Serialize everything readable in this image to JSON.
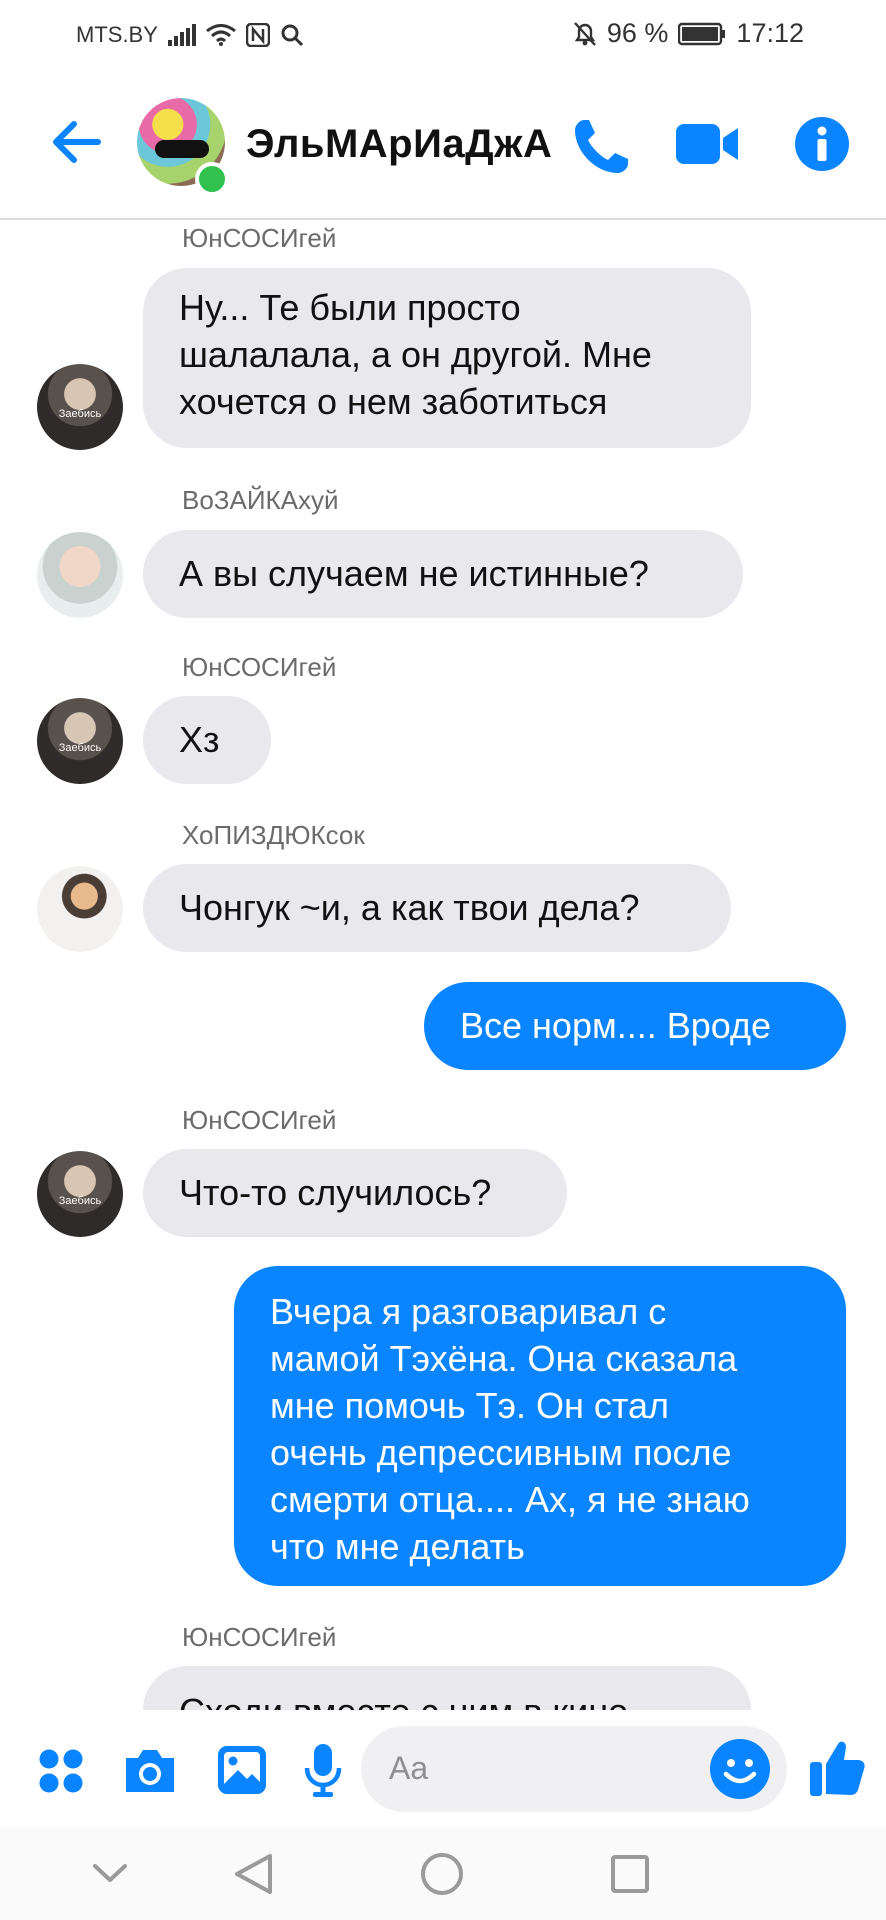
{
  "status_bar": {
    "carrier": "MTS.BY",
    "battery": "96 %",
    "time": "17:12"
  },
  "header": {
    "title": "ЭльМАрИаДжА",
    "back_icon": "arrow-left-icon",
    "call_icon": "phone-icon",
    "video_icon": "video-camera-icon",
    "info_icon": "info-icon",
    "accent_color": "#0b84ff",
    "online_color": "#31c24d"
  },
  "messages": [
    {
      "sender": "ЮнСОСИгей",
      "lines": [
        "Ну... Те были просто",
        "шалалала, а он другой. Мне",
        "хочется о нем заботиться"
      ]
    },
    {
      "sender": "ВоЗАЙКАхуй",
      "lines": [
        "А вы случаем не истинные?"
      ]
    },
    {
      "sender": "ЮнСОСИгей",
      "lines": [
        "Хз"
      ]
    },
    {
      "sender": "ХоПИЗДЮКсок",
      "lines": [
        "Чонгук ~и, а как твои дела?"
      ]
    },
    {
      "outgoing": true,
      "lines": [
        "Все норм.... Вроде"
      ]
    },
    {
      "sender": "ЮнСОСИгей",
      "lines": [
        "Что-то случилось?"
      ]
    },
    {
      "outgoing": true,
      "lines": [
        "Вчера я разговаривал с",
        "мамой Тэхёна. Она сказала",
        "мне помочь Тэ. Он стал",
        "очень депрессивным после",
        "смерти отца.... Ах, я не знаю",
        "что мне делать"
      ]
    },
    {
      "sender": "ЮнСОСИгей",
      "lines": [
        "Сходи вместе с ним в кино"
      ]
    }
  ],
  "avatar_watermark": "Заебись",
  "composer": {
    "placeholder": "Aa",
    "icons": [
      "apps-icon",
      "camera-icon",
      "image-icon",
      "microphone-icon",
      "emoji-icon",
      "thumbs-up-icon"
    ]
  },
  "nav": {
    "icons": [
      "chevron-down-icon",
      "back-triangle-icon",
      "home-circle-icon",
      "recents-square-icon"
    ]
  }
}
